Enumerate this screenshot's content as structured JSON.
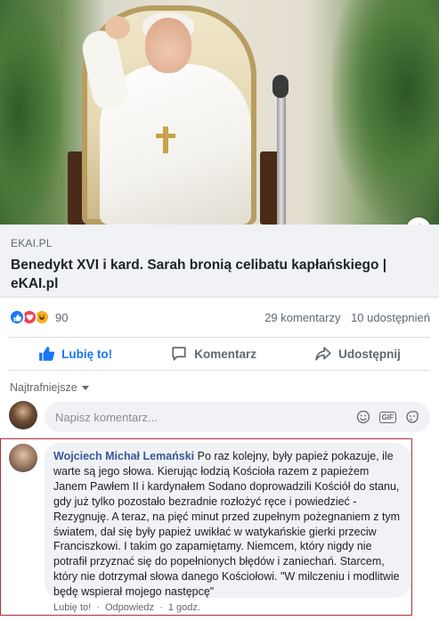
{
  "link_preview": {
    "domain": "EKAI.PL",
    "title": "Benedykt XVI i kard. Sarah bronią celibatu kapłańskiego | eKAI.pl",
    "info_icon": "info-icon"
  },
  "reactions": {
    "icons": [
      "like-icon",
      "love-icon",
      "haha-icon"
    ],
    "count": "90",
    "comments_count": "29 komentarzy",
    "shares_count": "10 udostępnień"
  },
  "actions": {
    "like_label": "Lubię to!",
    "comment_label": "Komentarz",
    "share_label": "Udostępnij"
  },
  "filter": {
    "label": "Najtrafniejsze"
  },
  "composer": {
    "placeholder": "Napisz komentarz..."
  },
  "comment": {
    "author": "Wojciech Michał Lemański",
    "text": "Po raz kolejny, były papież pokazuje, ile warte są jego słowa. Kierując łodzią Kościoła razem z papieżem Janem Pawłem II i kardynałem Sodano doprowadzili Kościół do stanu, gdy już tylko pozostało bezradnie rozłożyć ręce i powiedzieć - Rezygnuję. A teraz, na pięć minut przed zupełnym pożegnaniem z tym światem, dał się były papież uwikłać w watykańskie gierki przeciw Franciszkowi. I takim go zapamiętamy. Niemcem, który nigdy nie potrafił przyznać się do popełnionych błędów i zaniechań. Starcem, który nie dotrzymał słowa danego Kościołowi. \"W milczeniu i modlitwie będę wspierał mojego następcę\"",
    "like_link": "Lubię to!",
    "reply_link": "Odpowiedz",
    "time": "1 godz."
  },
  "colors": {
    "accent": "#1877f2",
    "highlight_border": "#b1303a",
    "author_link": "#385898"
  }
}
